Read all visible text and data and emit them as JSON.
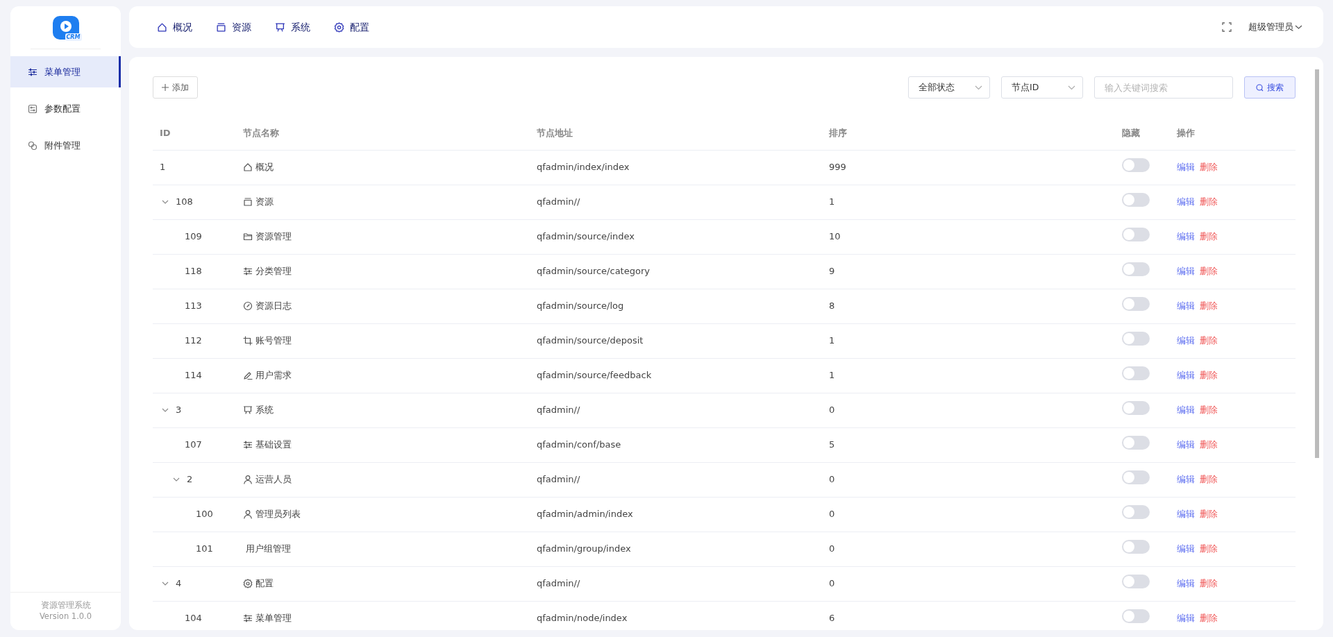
{
  "sidebar": {
    "logo_text": "CRM",
    "items": [
      {
        "label": "菜单管理",
        "selected": true
      },
      {
        "label": "参数配置",
        "selected": false
      },
      {
        "label": "附件管理",
        "selected": false
      }
    ],
    "footer": {
      "name": "资源管理系统",
      "version": "Version 1.0.0"
    }
  },
  "top_nav": [
    {
      "label": "概况"
    },
    {
      "label": "资源"
    },
    {
      "label": "系统"
    },
    {
      "label": "配置"
    }
  ],
  "user": {
    "label": "超级管理员"
  },
  "toolbar": {
    "add_button": "添加",
    "status_select": "全部状态",
    "field_select": "节点ID",
    "search": {
      "placeholder": "输入关键词搜索"
    },
    "search_button": "搜索"
  },
  "table": {
    "columns": [
      "ID",
      "节点名称",
      "节点地址",
      "排序",
      "隐藏",
      "操作"
    ],
    "rows": [
      {
        "id": "1",
        "name": "概况",
        "address": "qfadmin/index/index",
        "sort": "999",
        "hidden": false,
        "actions": [
          "编辑",
          "删除"
        ]
      },
      {
        "id": "108",
        "name": "资源",
        "address": "qfadmin//",
        "sort": "1",
        "hidden": false,
        "actions": [
          "编辑",
          "删除"
        ],
        "expanded": true,
        "children": [
          {
            "id": "109",
            "name": "资源管理",
            "address": "qfadmin/source/index",
            "sort": "10",
            "hidden": false,
            "actions": [
              "编辑",
              "删除"
            ]
          },
          {
            "id": "118",
            "name": "分类管理",
            "address": "qfadmin/source/category",
            "sort": "9",
            "hidden": false,
            "actions": [
              "编辑",
              "删除"
            ]
          },
          {
            "id": "113",
            "name": "资源日志",
            "address": "qfadmin/source/log",
            "sort": "8",
            "hidden": false,
            "actions": [
              "编辑",
              "删除"
            ]
          },
          {
            "id": "112",
            "name": "账号管理",
            "address": "qfadmin/source/deposit",
            "sort": "1",
            "hidden": false,
            "actions": [
              "编辑",
              "删除"
            ]
          },
          {
            "id": "114",
            "name": "用户需求",
            "address": "qfadmin/source/feedback",
            "sort": "1",
            "hidden": false,
            "actions": [
              "编辑",
              "删除"
            ]
          }
        ]
      },
      {
        "id": "3",
        "name": "系统",
        "address": "qfadmin//",
        "sort": "0",
        "hidden": false,
        "actions": [
          "编辑",
          "删除"
        ],
        "expanded": true,
        "children": [
          {
            "id": "107",
            "name": "基础设置",
            "address": "qfadmin/conf/base",
            "sort": "5",
            "hidden": false,
            "actions": [
              "编辑",
              "删除"
            ]
          },
          {
            "id": "2",
            "name": "运营人员",
            "address": "qfadmin//",
            "sort": "0",
            "hidden": false,
            "actions": [
              "编辑",
              "删除"
            ],
            "expanded": true,
            "children": [
              {
                "id": "100",
                "name": "管理员列表",
                "address": "qfadmin/admin/index",
                "sort": "0",
                "hidden": false,
                "actions": [
                  "编辑",
                  "删除"
                ]
              },
              {
                "id": "101",
                "name": "用户组管理",
                "address": "qfadmin/group/index",
                "sort": "0",
                "hidden": false,
                "actions": [
                  "编辑",
                  "删除"
                ]
              }
            ]
          }
        ]
      },
      {
        "id": "4",
        "name": "配置",
        "address": "qfadmin//",
        "sort": "0",
        "hidden": false,
        "actions": [
          "编辑",
          "删除"
        ],
        "expanded": true,
        "children": [
          {
            "id": "104",
            "name": "菜单管理",
            "address": "qfadmin/node/index",
            "sort": "6",
            "hidden": false,
            "actions": [
              "编辑",
              "删除"
            ]
          }
        ]
      }
    ]
  }
}
